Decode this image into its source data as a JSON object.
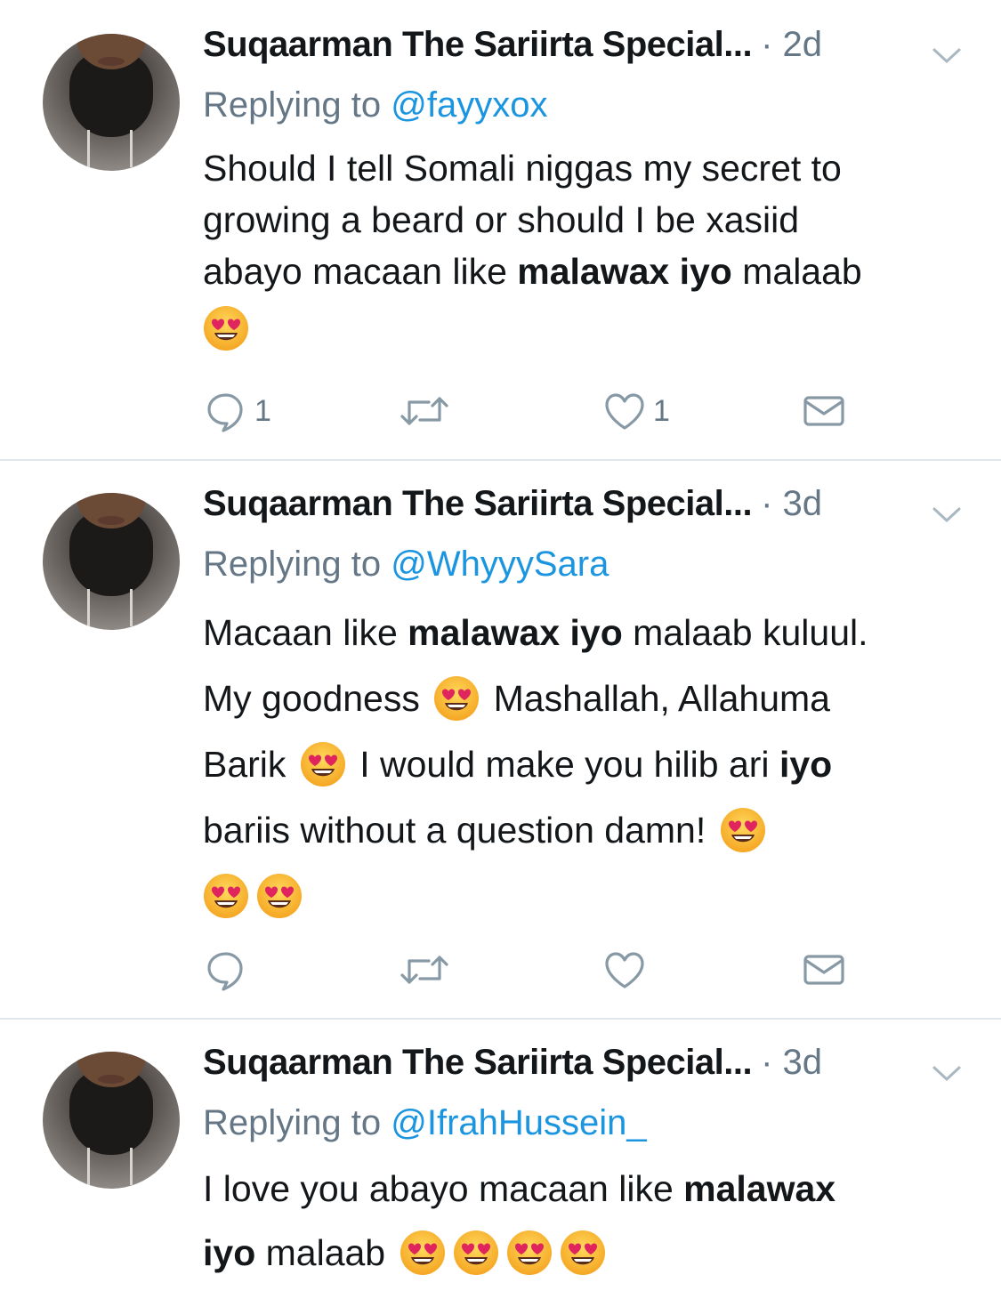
{
  "tweets": [
    {
      "author": "Suqaarman The Sariirta Special...",
      "time": "· 2d",
      "reply_prefix": "Replying to",
      "reply_handle": "@fayyxox",
      "lines": [
        [
          "Should I tell Somali niggas my secret to"
        ],
        [
          "growing a beard or should I be xasiid"
        ],
        [
          "abayo macaan like ",
          "malawax iyo",
          " malaab"
        ],
        []
      ],
      "reply_count": "1",
      "like_count": "1"
    },
    {
      "author": "Suqaarman The Sariirta Special...",
      "time": "· 3d",
      "reply_prefix": "Replying to",
      "reply_handle": "@WhyyySara",
      "lines": [
        [
          "Macaan like ",
          "malawax iyo",
          " malaab kuluul."
        ],
        [
          "My goodness ",
          "",
          " Mashallah, Allahuma"
        ],
        [
          "Barik ",
          "",
          " I would make you hilib ari ",
          "iyo"
        ],
        [
          "bariis without a question damn! "
        ],
        []
      ],
      "reply_count": "",
      "like_count": ""
    },
    {
      "author": "Suqaarman The Sariirta Special...",
      "time": "· 3d",
      "reply_prefix": "Replying to",
      "reply_handle": "@IfrahHussein_",
      "lines": [
        [
          "I love you abayo macaan like ",
          "malawax"
        ],
        [
          "iyo",
          " malaab "
        ]
      ]
    }
  ],
  "icons": {
    "reply": "reply-icon",
    "retweet": "retweet-icon",
    "like": "heart-icon",
    "dm": "mail-icon",
    "caret": "chevron-down-icon",
    "emoji": "heart-eyes-emoji"
  },
  "colors": {
    "name": "#14171a",
    "muted": "#657786",
    "link": "#1b95e0",
    "divider": "#e1e8ed"
  }
}
